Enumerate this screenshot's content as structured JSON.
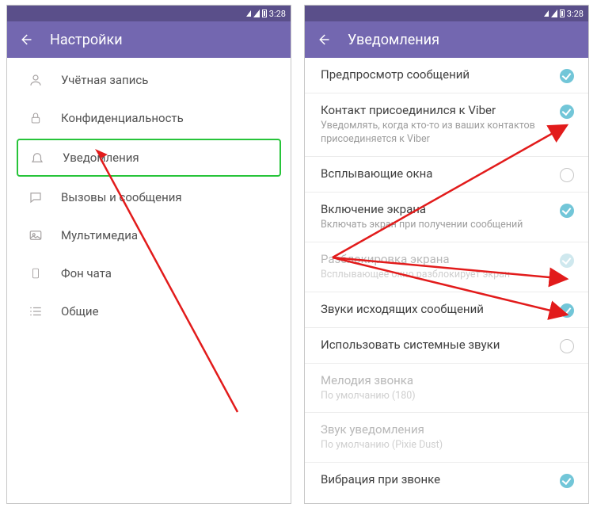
{
  "status": {
    "time": "3:28"
  },
  "left": {
    "title": "Настройки",
    "items": [
      {
        "icon": "user-icon",
        "label": "Учётная запись"
      },
      {
        "icon": "lock-icon",
        "label": "Конфиденциальность"
      },
      {
        "icon": "bell-icon",
        "label": "Уведомления",
        "highlight": true
      },
      {
        "icon": "chat-icon",
        "label": "Вызовы и сообщения"
      },
      {
        "icon": "media-icon",
        "label": "Мультимедиа"
      },
      {
        "icon": "wallpaper-icon",
        "label": "Фон чата"
      },
      {
        "icon": "list-icon",
        "label": "Общие"
      }
    ]
  },
  "right": {
    "title": "Уведомления",
    "settings": [
      {
        "title": "Предпросмотр сообщений",
        "state": "on"
      },
      {
        "title": "Контакт присоединился к Viber",
        "sub": "Уведомлять, когда кто-то из ваших контактов присоединяется к Viber",
        "state": "on"
      },
      {
        "title": "Всплывающие окна",
        "state": "off"
      },
      {
        "title": "Включение экрана",
        "sub": "Включать экран при получении сообщений",
        "state": "on"
      },
      {
        "title": "Разблокировка экрана",
        "sub": "Всплывающее окно разблокирует экран",
        "state": "ondis",
        "disabled": true
      },
      {
        "title": "Звуки исходящих сообщений",
        "state": "on"
      },
      {
        "title": "Использовать системные звуки",
        "state": "off"
      },
      {
        "title": "Мелодия звонка",
        "sub": "По умолчанию (180)",
        "disabled": true
      },
      {
        "title": "Звук уведомления",
        "sub": "По умолчанию (Pixie Dust)",
        "disabled": true
      },
      {
        "title": "Вибрация при звонке",
        "state": "on"
      }
    ]
  }
}
